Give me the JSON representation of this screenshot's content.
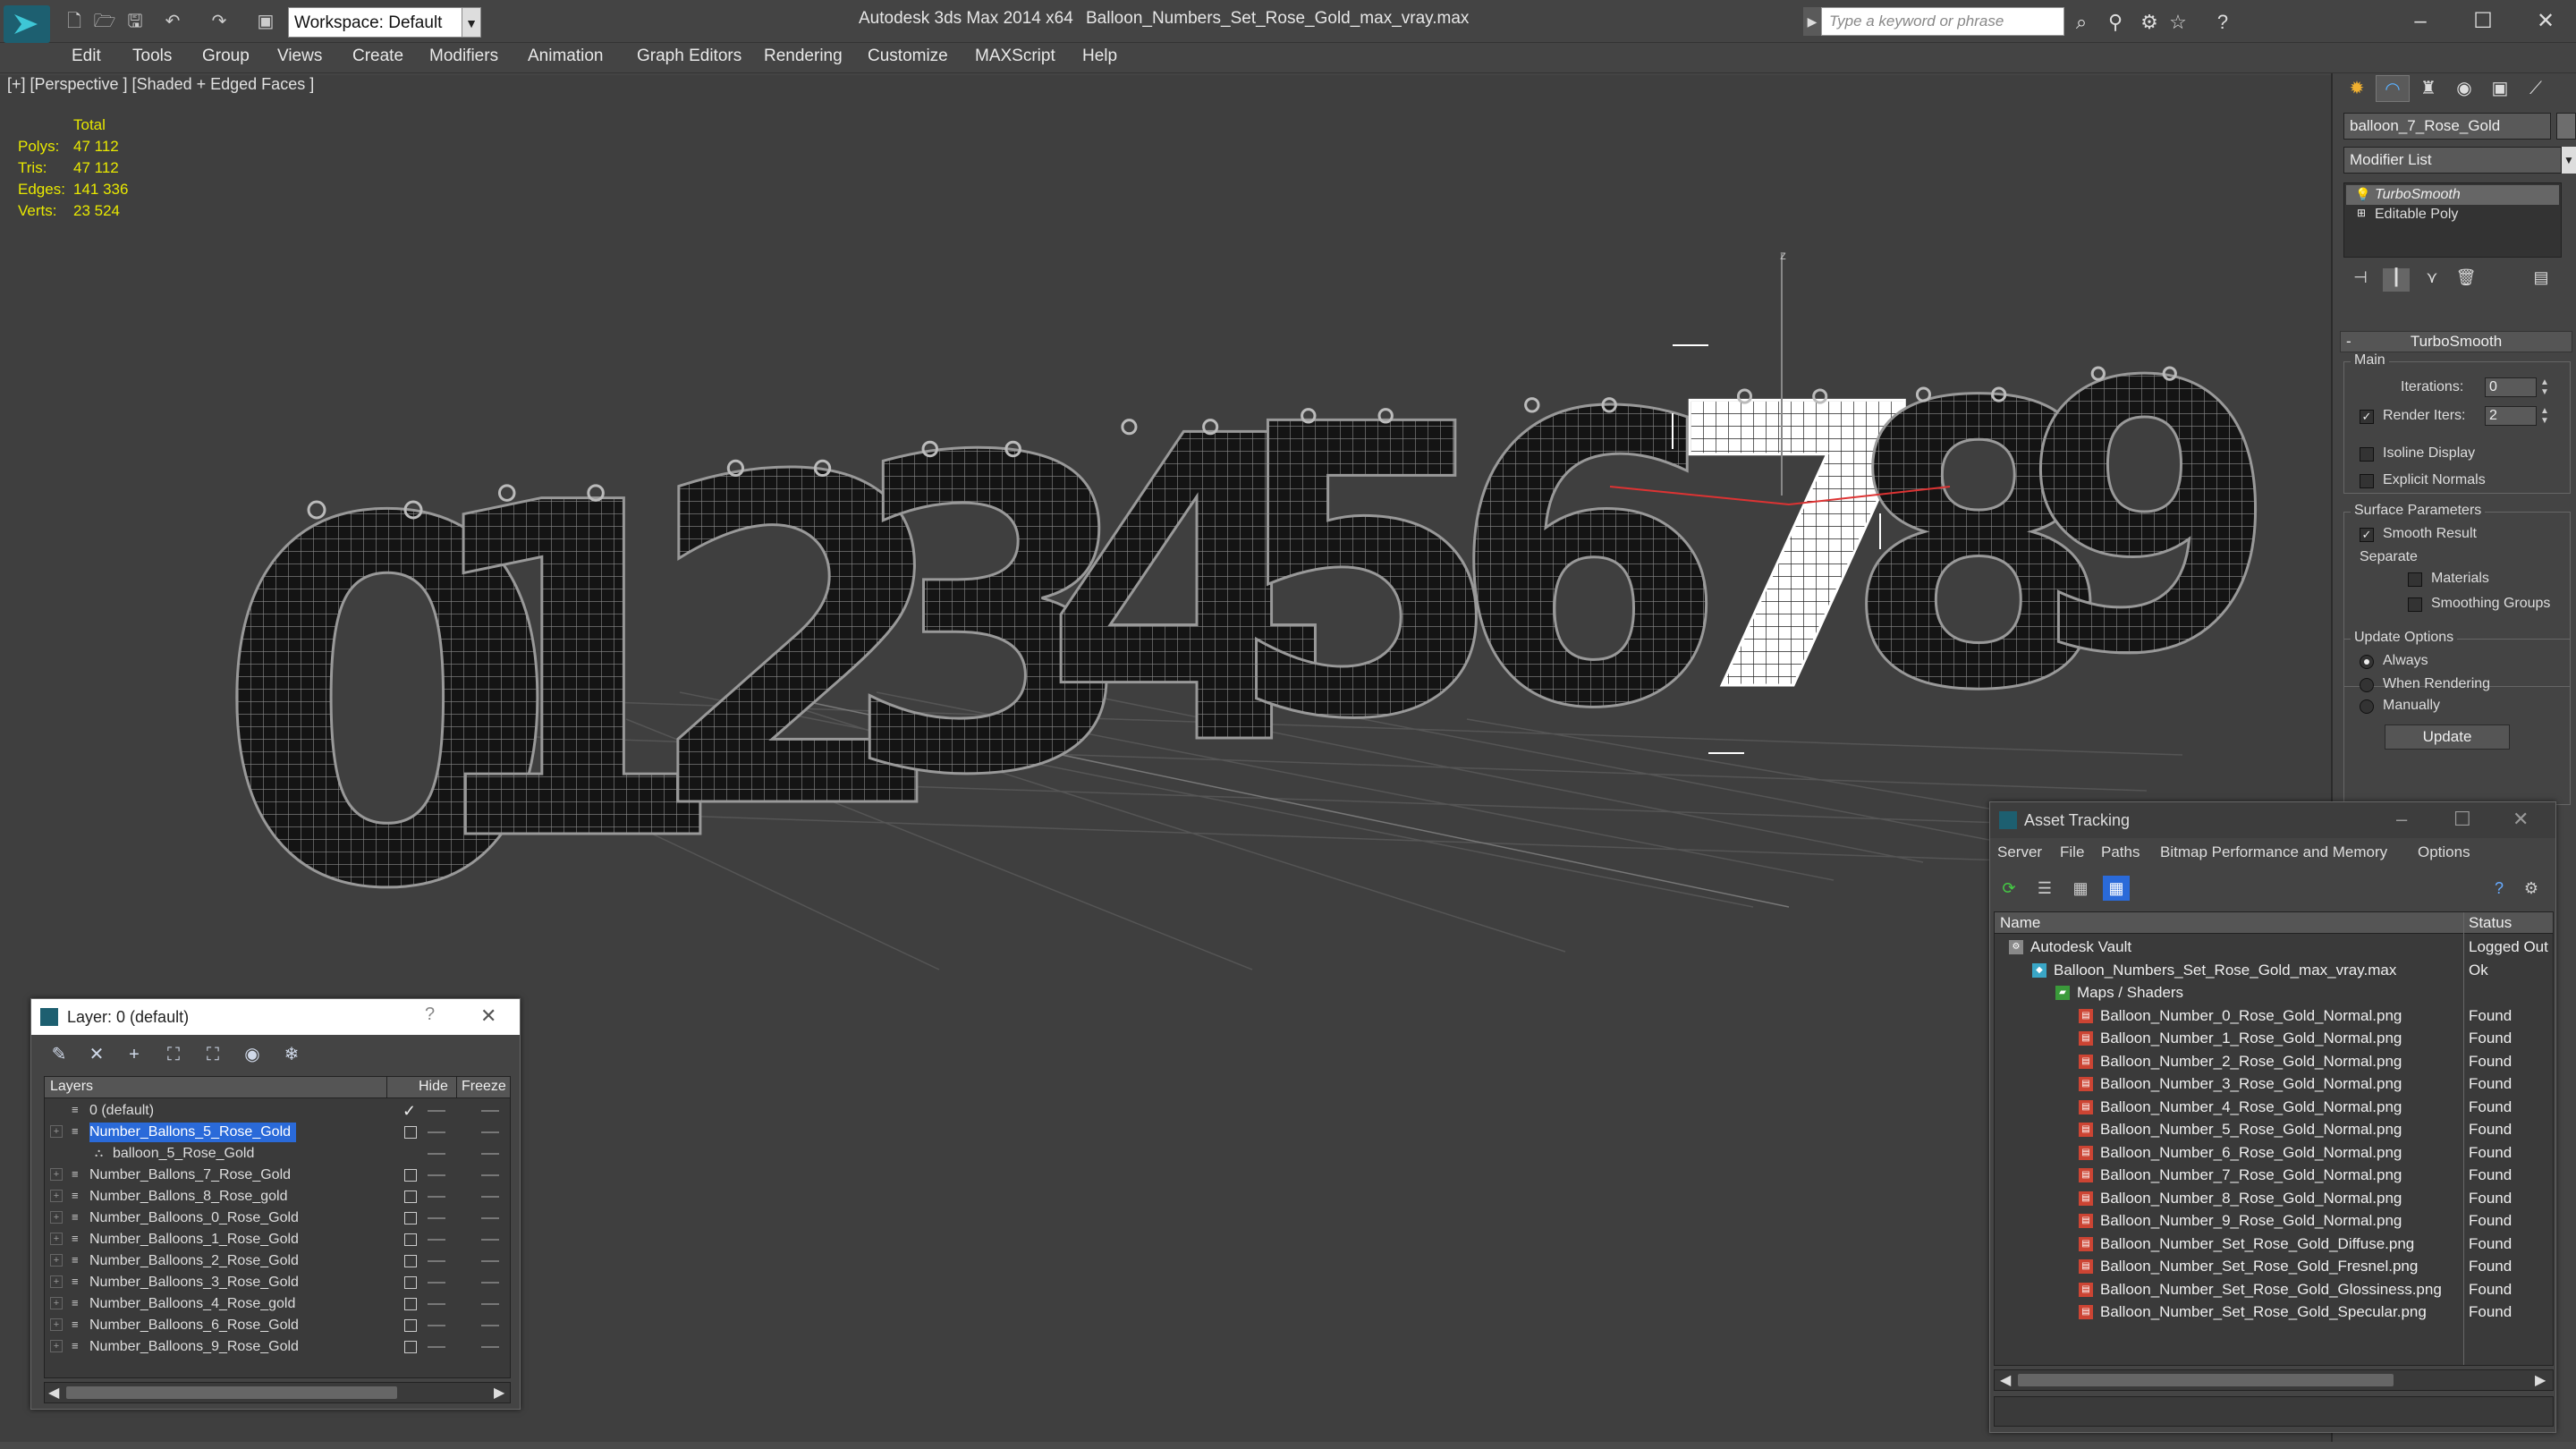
{
  "app": {
    "title": "Autodesk 3ds Max  2014 x64",
    "file": "Balloon_Numbers_Set_Rose_Gold_max_vray.max",
    "workspace": "Workspace: Default",
    "search_placeholder": "Type a keyword or phrase",
    "accent": "#2a6ad9"
  },
  "menu": [
    "Edit",
    "Tools",
    "Group",
    "Views",
    "Create",
    "Modifiers",
    "Animation",
    "Graph Editors",
    "Rendering",
    "Customize",
    "MAXScript",
    "Help"
  ],
  "viewport": {
    "label": "[+] [Perspective ] [Shaded + Edged Faces ]",
    "stats": {
      "header": "Total",
      "rows": [
        {
          "key": "Polys:",
          "value": "47 112"
        },
        {
          "key": "Tris:",
          "value": "47 112"
        },
        {
          "key": "Edges:",
          "value": "141 336"
        },
        {
          "key": "Verts:",
          "value": "23 524"
        }
      ]
    },
    "digits": [
      "0",
      "1",
      "2",
      "3",
      "4",
      "5",
      "6",
      "7",
      "8",
      "9"
    ],
    "axis_label": "z"
  },
  "command_panel": {
    "object_name": "balloon_7_Rose_Gold",
    "modifier_list": "Modifier List",
    "stack": [
      "TurboSmooth",
      "Editable Poly"
    ],
    "rollout_title": "TurboSmooth",
    "main_label": "Main",
    "iterations_label": "Iterations:",
    "iterations_value": "0",
    "render_iters_label": "Render Iters:",
    "render_iters_value": "2",
    "isoline_label": "Isoline Display",
    "explicit_label": "Explicit Normals",
    "surface_label": "Surface Parameters",
    "smooth_label": "Smooth Result",
    "separate_label": "Separate",
    "materials_label": "Materials",
    "smoothing_label": "Smoothing Groups",
    "update_options_label": "Update Options",
    "always_label": "Always",
    "when_rendering_label": "When Rendering",
    "manually_label": "Manually",
    "update_button": "Update",
    "collapse_mark": "-"
  },
  "layer_window": {
    "title": "Layer: 0 (default)",
    "help": "?",
    "col_layers": "Layers",
    "col_hide": "Hide",
    "col_freeze": "Freeze",
    "rows": [
      {
        "name": "0 (default)",
        "indent": 0,
        "active": true
      },
      {
        "name": "Number_Ballons_5_Rose_Gold",
        "indent": 0,
        "selected": true
      },
      {
        "name": "balloon_5_Rose_Gold",
        "indent": 1
      },
      {
        "name": "Number_Ballons_7_Rose_Gold",
        "indent": 0
      },
      {
        "name": "Number_Ballons_8_Rose_gold",
        "indent": 0
      },
      {
        "name": "Number_Balloons_0_Rose_Gold",
        "indent": 0
      },
      {
        "name": "Number_Balloons_1_Rose_Gold",
        "indent": 0
      },
      {
        "name": "Number_Balloons_2_Rose_Gold",
        "indent": 0
      },
      {
        "name": "Number_Balloons_3_Rose_Gold",
        "indent": 0
      },
      {
        "name": "Number_Balloons_4_Rose_gold",
        "indent": 0
      },
      {
        "name": "Number_Balloons_6_Rose_Gold",
        "indent": 0
      },
      {
        "name": "Number_Balloons_9_Rose_Gold",
        "indent": 0
      }
    ]
  },
  "asset_window": {
    "title": "Asset Tracking",
    "menu": [
      "Server",
      "File",
      "Paths",
      "Bitmap Performance and Memory",
      "Options"
    ],
    "col_name": "Name",
    "col_status": "Status",
    "rows": [
      {
        "name": "Autodesk Vault",
        "status": "Logged Out",
        "level": 0,
        "icon": "vault-icon"
      },
      {
        "name": "Balloon_Numbers_Set_Rose_Gold_max_vray.max",
        "status": "Ok",
        "level": 1,
        "icon": "max-file-icon"
      },
      {
        "name": "Maps / Shaders",
        "status": "",
        "level": 2,
        "icon": "maps-icon"
      },
      {
        "name": "Balloon_Number_0_Rose_Gold_Normal.png",
        "status": "Found",
        "level": 3,
        "icon": "png-icon"
      },
      {
        "name": "Balloon_Number_1_Rose_Gold_Normal.png",
        "status": "Found",
        "level": 3,
        "icon": "png-icon"
      },
      {
        "name": "Balloon_Number_2_Rose_Gold_Normal.png",
        "status": "Found",
        "level": 3,
        "icon": "png-icon"
      },
      {
        "name": "Balloon_Number_3_Rose_Gold_Normal.png",
        "status": "Found",
        "level": 3,
        "icon": "png-icon"
      },
      {
        "name": "Balloon_Number_4_Rose_Gold_Normal.png",
        "status": "Found",
        "level": 3,
        "icon": "png-icon"
      },
      {
        "name": "Balloon_Number_5_Rose_Gold_Normal.png",
        "status": "Found",
        "level": 3,
        "icon": "png-icon"
      },
      {
        "name": "Balloon_Number_6_Rose_Gold_Normal.png",
        "status": "Found",
        "level": 3,
        "icon": "png-icon"
      },
      {
        "name": "Balloon_Number_7_Rose_Gold_Normal.png",
        "status": "Found",
        "level": 3,
        "icon": "png-icon"
      },
      {
        "name": "Balloon_Number_8_Rose_Gold_Normal.png",
        "status": "Found",
        "level": 3,
        "icon": "png-icon"
      },
      {
        "name": "Balloon_Number_9_Rose_Gold_Normal.png",
        "status": "Found",
        "level": 3,
        "icon": "png-icon"
      },
      {
        "name": "Balloon_Number_Set_Rose_Gold_Diffuse.png",
        "status": "Found",
        "level": 3,
        "icon": "png-icon"
      },
      {
        "name": "Balloon_Number_Set_Rose_Gold_Fresnel.png",
        "status": "Found",
        "level": 3,
        "icon": "png-icon"
      },
      {
        "name": "Balloon_Number_Set_Rose_Gold_Glossiness.png",
        "status": "Found",
        "level": 3,
        "icon": "png-icon"
      },
      {
        "name": "Balloon_Number_Set_Rose_Gold_Specular.png",
        "status": "Found",
        "level": 3,
        "icon": "png-icon"
      }
    ]
  }
}
